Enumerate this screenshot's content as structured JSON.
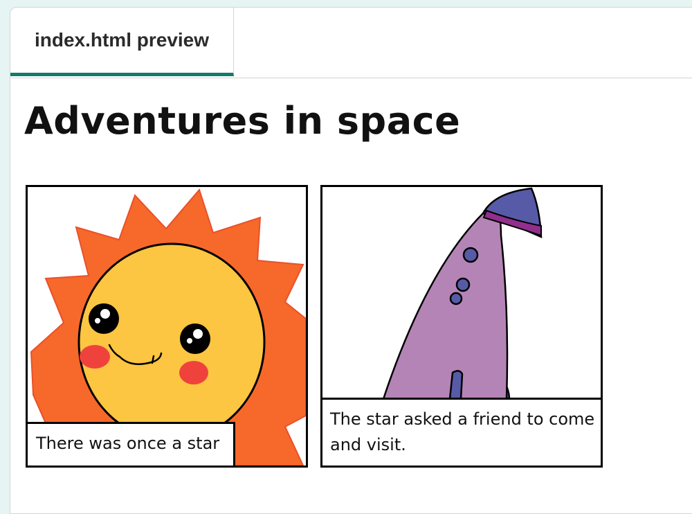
{
  "tab": {
    "label": "index.html preview"
  },
  "page": {
    "title": "Adventures in space"
  },
  "panels": [
    {
      "caption": "There was once a star",
      "image": "smiling-sun-illustration"
    },
    {
      "caption": "The star asked a friend to come and visit.",
      "image": "purple-rocket-illustration"
    }
  ],
  "colors": {
    "accent": "#137a6e",
    "sun_rays": "#f7682b",
    "sun_face": "#fcc542",
    "cheeks": "#f0423c",
    "rocket_body": "#b584b6",
    "rocket_nose": "#575aa6",
    "rocket_stripe": "#922e8c"
  }
}
